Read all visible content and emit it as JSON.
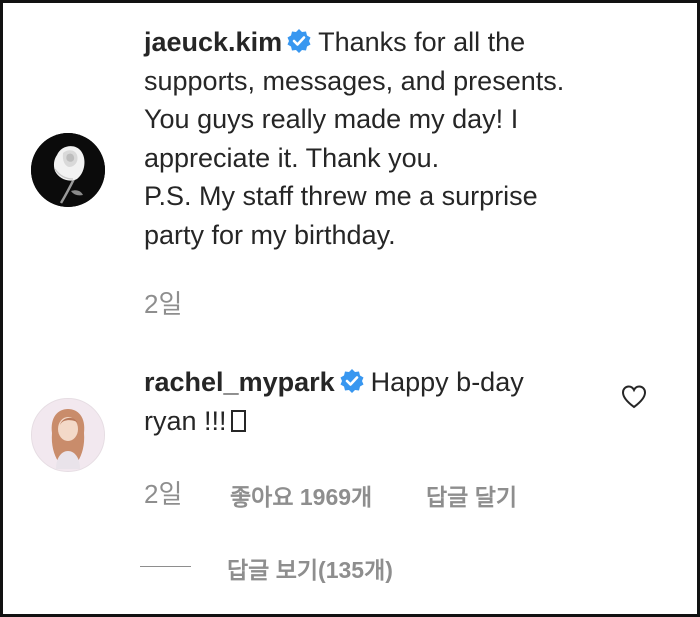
{
  "comments": [
    {
      "username": "jaeuck.kim",
      "text_lines": [
        "Thanks for all the",
        "supports, messages, and presents.",
        "You guys really made my day! I",
        "appreciate it. Thank you.",
        "P.S. My staff threw me a surprise",
        "party for my birthday."
      ],
      "time": "2일",
      "avatar_icon": "white-rose-avatar"
    },
    {
      "username": "rachel_mypark",
      "text_line1": "Happy b-day",
      "text_line2": "ryan !!!",
      "time": "2일",
      "likes_label": "좋아요 1969개",
      "reply_label": "답글 달기",
      "avatar_icon": "woman-portrait-avatar"
    }
  ],
  "view_replies_label": "답글 보기(135개)",
  "colors": {
    "text": "#262626",
    "muted": "#8e8e8e",
    "verified_blue": "#3897f0",
    "frame": "#111111"
  }
}
